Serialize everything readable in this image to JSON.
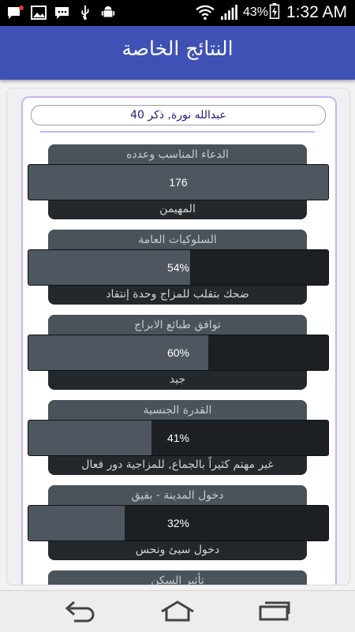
{
  "status_bar": {
    "time": "1:32 AM",
    "battery_percent": "43%",
    "icons": [
      "message-icon",
      "image-icon",
      "chat-icon",
      "usb-icon",
      "android-debug-icon",
      "wifi-icon",
      "signal-icon",
      "battery-charging-icon"
    ]
  },
  "app_bar": {
    "title": "النتائج الخاصة",
    "color": "#3f51b5"
  },
  "person": {
    "name_line": "عبدالله نورة, ذكر 40"
  },
  "results": [
    {
      "title": "الدعاء المناسب وعدده",
      "value": "176",
      "fill_percent": 100,
      "description": "المهيمن"
    },
    {
      "title": "السلوكيات العامة",
      "value": "54%",
      "fill_percent": 54,
      "description": "ضحك بتقلب للمزاج وحدة إنتقاد"
    },
    {
      "title": "توافق طبائع الابراج",
      "value": "60%",
      "fill_percent": 60,
      "description": "جيد"
    },
    {
      "title": "القدرة الجنسية",
      "value": "41%",
      "fill_percent": 41,
      "description": "غير مهتم كثيراً بالجماع, للمزاجية دور فعال"
    },
    {
      "title": "دخول المدينة - بقيق",
      "value": "32%",
      "fill_percent": 32,
      "description": "دخول سيئ ونحس"
    },
    {
      "title": "تأثير السكن",
      "value": "",
      "fill_percent": 0,
      "description": ""
    }
  ],
  "nav_bar": {
    "buttons": [
      "back-icon",
      "home-icon",
      "recent-apps-icon"
    ]
  }
}
